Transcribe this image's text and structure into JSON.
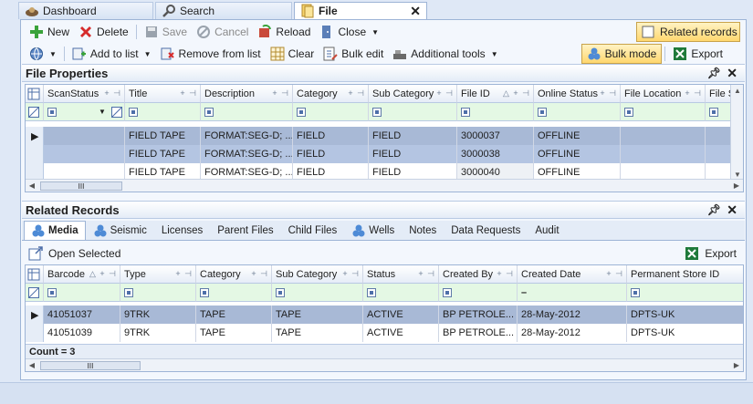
{
  "tabs": [
    {
      "label": "Dashboard",
      "icon": "dashboard-icon"
    },
    {
      "label": "Search",
      "icon": "search-icon"
    },
    {
      "label": "File",
      "icon": "file-icon",
      "active": true
    }
  ],
  "toolbar1": {
    "new": "New",
    "delete": "Delete",
    "save": "Save",
    "cancel": "Cancel",
    "reload": "Reload",
    "close": "Close",
    "related": "Related records"
  },
  "toolbar2": {
    "add_to_list": "Add to list",
    "remove_from_list": "Remove from list",
    "clear": "Clear",
    "bulk_edit": "Bulk edit",
    "additional_tools": "Additional tools",
    "bulk_mode": "Bulk mode",
    "export": "Export"
  },
  "file_properties": {
    "title": "File Properties",
    "columns": [
      "ScanStatus",
      "Title",
      "Description",
      "Category",
      "Sub Category",
      "File ID",
      "Online Status",
      "File Location",
      "File S"
    ],
    "rows": [
      {
        "title": "FIELD TAPE",
        "description": "FORMAT:SEG-D; ...",
        "category": "FIELD",
        "sub_category": "FIELD",
        "file_id": "3000037",
        "online_status": "OFFLINE"
      },
      {
        "title": "FIELD TAPE",
        "description": "FORMAT:SEG-D; ...",
        "category": "FIELD",
        "sub_category": "FIELD",
        "file_id": "3000038",
        "online_status": "OFFLINE"
      },
      {
        "title": "FIELD TAPE",
        "description": "FORMAT:SEG-D; ...",
        "category": "FIELD",
        "sub_category": "FIELD",
        "file_id": "3000040",
        "online_status": "OFFLINE"
      }
    ],
    "scroll_label": "III"
  },
  "related_records": {
    "title": "Related Records",
    "tabs": [
      "Media",
      "Seismic",
      "Licenses",
      "Parent Files",
      "Child Files",
      "Wells",
      "Notes",
      "Data Requests",
      "Audit"
    ],
    "open_selected": "Open Selected",
    "export": "Export",
    "columns": [
      "Barcode",
      "Type",
      "Category",
      "Sub Category",
      "Status",
      "Created By",
      "Created Date",
      "Permanent Store ID"
    ],
    "rows": [
      {
        "barcode": "41051037",
        "type": "9TRK",
        "category": "TAPE",
        "sub_category": "TAPE",
        "status": "ACTIVE",
        "created_by": "BP PETROLE...",
        "created_date": "28-May-2012",
        "store_id": "DPTS-UK"
      },
      {
        "barcode": "41051039",
        "type": "9TRK",
        "category": "TAPE",
        "sub_category": "TAPE",
        "status": "ACTIVE",
        "created_by": "BP PETROLE...",
        "created_date": "28-May-2012",
        "store_id": "DPTS-UK"
      }
    ],
    "count": "Count = 3",
    "scroll_label": "III"
  }
}
